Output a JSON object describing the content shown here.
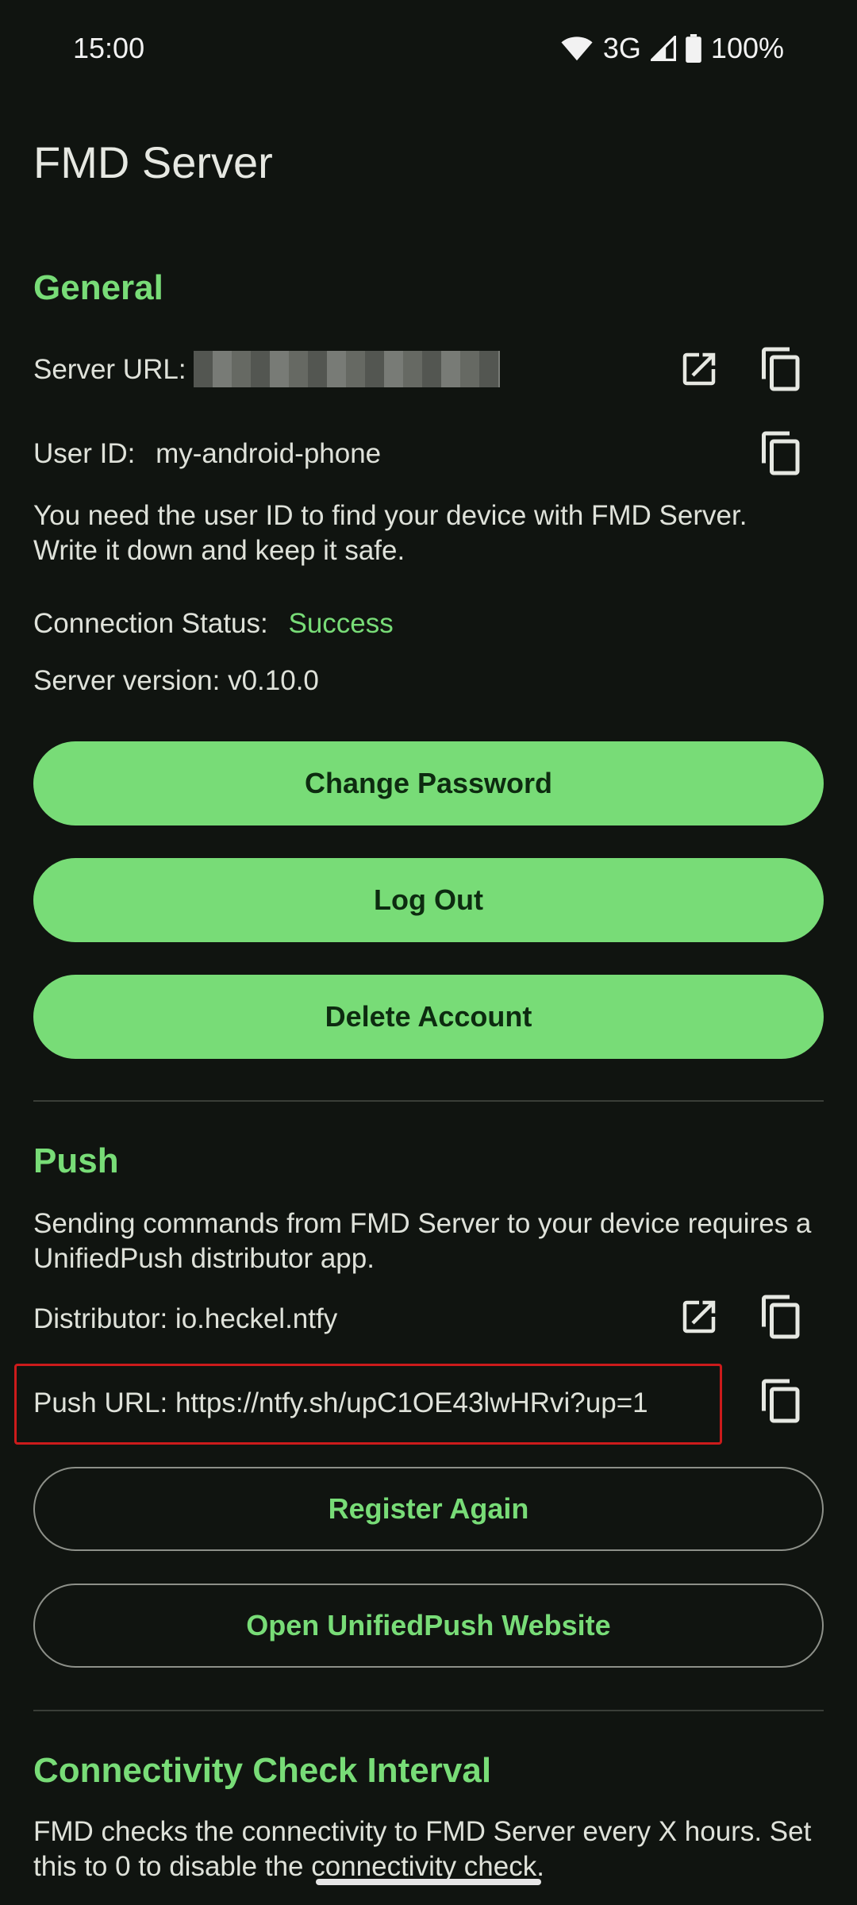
{
  "status": {
    "time": "15:00",
    "network": "3G",
    "battery": "100%"
  },
  "app_title": "FMD Server",
  "general": {
    "section_title": "General",
    "server_url_label": "Server URL:",
    "user_id_label": "User ID:",
    "user_id_value": "my-android-phone",
    "user_id_hint": "You need the user ID to find your device with FMD Server. Write it down and keep it safe.",
    "connection_status_label": "Connection Status:",
    "connection_status_value": "Success",
    "server_version": "Server version: v0.10.0",
    "buttons": {
      "change_password": "Change Password",
      "log_out": "Log Out",
      "delete_account": "Delete Account"
    }
  },
  "push": {
    "section_title": "Push",
    "description": "Sending commands from FMD Server to your device requires a UnifiedPush distributor app.",
    "distributor": "Distributor: io.heckel.ntfy",
    "push_url": "Push URL: https://ntfy.sh/upC1OE43lwHRvi?up=1",
    "buttons": {
      "register_again": "Register Again",
      "open_website": "Open UnifiedPush Website"
    }
  },
  "connectivity": {
    "section_title": "Connectivity Check Interval",
    "description": "FMD checks the connectivity to FMD Server every X hours. Set this to 0 to disable the connectivity check."
  },
  "colors": {
    "accent": "#78dc77",
    "background": "#101410",
    "highlight": "#cc1b1b"
  },
  "icons": {
    "open": "open-external-icon",
    "copy": "copy-icon"
  }
}
